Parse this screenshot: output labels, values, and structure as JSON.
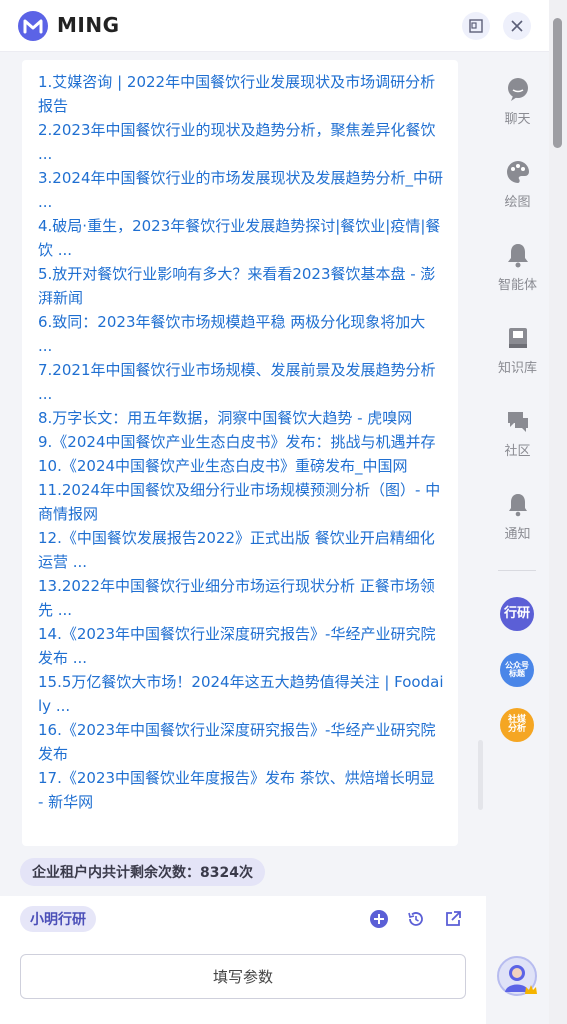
{
  "header": {
    "brand": "MING"
  },
  "references": [
    "1.艾媒咨询 | 2022年中国餐饮行业发展现状及市场调研分析报告",
    "2.2023年中国餐饮行业的现状及趋势分析，聚焦差异化餐饮 ...",
    "3.2024年中国餐饮行业的市场发展现状及发展趋势分析_中研 ...",
    "4.破局·重生，2023年餐饮行业发展趋势探讨|餐饮业|疫情|餐饮 ...",
    "5.放开对餐饮行业影响有多大？来看看2023餐饮基本盘 - 澎湃新闻",
    "6.致同：2023年餐饮市场规模趋平稳 两极分化现象将加大 ...",
    "7.2021年中国餐饮行业市场规模、发展前景及发展趋势分析 ...",
    "8.万字长文：用五年数据，洞察中国餐饮大趋势 - 虎嗅网",
    "9.《2024中国餐饮产业生态白皮书》发布：挑战与机遇并存",
    "10.《2024中国餐饮产业生态白皮书》重磅发布_中国网",
    "11.2024年中国餐饮及细分行业市场规模预测分析（图）- 中商情报网",
    "12.《中国餐饮发展报告2022》正式出版 餐饮业开启精细化运营 ...",
    "13.2022年中国餐饮行业细分市场运行现状分析 正餐市场领先 ...",
    "14.《2023年中国餐饮行业深度研究报告》-华经产业研究院发布 ...",
    "15.5万亿餐饮大市场！2024年这五大趋势值得关注 | Foodaily ...",
    "16.《2023年中国餐饮行业深度研究报告》-华经产业研究院发布",
    "17.《2023中国餐饮业年度报告》发布 茶饮、烘焙增长明显 - 新华网"
  ],
  "quota": {
    "text": "企业租户内共计剩余次数：8324次"
  },
  "composer": {
    "tag": "小明行研",
    "param_button": "填写参数"
  },
  "sidebar": {
    "items": [
      {
        "label": "聊天",
        "icon": "chat-icon"
      },
      {
        "label": "绘图",
        "icon": "palette-icon"
      },
      {
        "label": "智能体",
        "icon": "agent-icon"
      },
      {
        "label": "知识库",
        "icon": "book-icon"
      },
      {
        "label": "社区",
        "icon": "community-icon"
      },
      {
        "label": "通知",
        "icon": "bell-icon"
      }
    ],
    "apps": [
      {
        "label": "行研",
        "color": "#5b5fd6"
      },
      {
        "label": "公众号标题",
        "color": "#4a86e8"
      },
      {
        "label": "社媒分析",
        "color": "#f5a623"
      }
    ]
  },
  "colors": {
    "accent": "#5b63e6",
    "link": "#1f6fd1"
  }
}
